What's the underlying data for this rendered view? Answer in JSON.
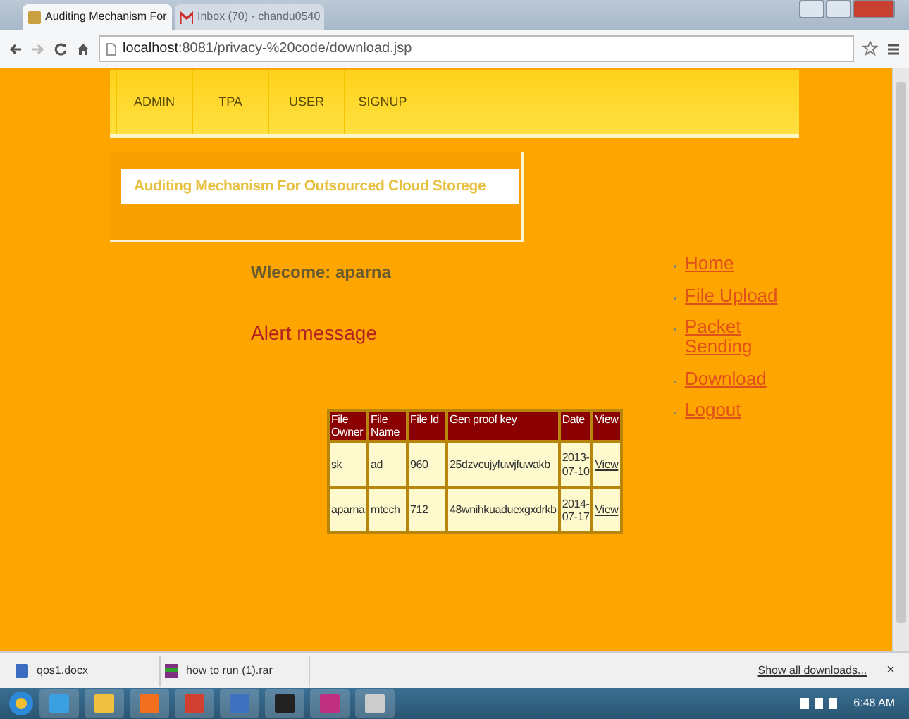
{
  "browser": {
    "tabs": [
      {
        "title": "Auditing Mechanism For",
        "selected": true
      },
      {
        "title": "Inbox (70) - chandu0540",
        "selected": false
      }
    ],
    "url_host": "localhost",
    "url_rest": ":8081/privacy-%20code/download.jsp"
  },
  "nav": [
    "ADMIN",
    "TPA",
    "USER",
    "SIGNUP"
  ],
  "banner": "Auditing Mechanism For Outsourced Cloud Storege",
  "welcome": "Wlecome: aparna",
  "alert": "Alert message",
  "table": {
    "columns": [
      "File Owner",
      "File Name",
      "File Id",
      "Gen proof key",
      "Date",
      "View"
    ],
    "rows": [
      [
        "sk",
        "ad",
        "960",
        "25dzvcujyfuwjfuwakb",
        "2013-07-10",
        "View"
      ],
      [
        "aparna",
        "mtech",
        "712",
        "48wnihkuaduexgxdrkb",
        "2014-07-17",
        "View"
      ]
    ]
  },
  "links": [
    "Home",
    "File Upload",
    "Packet Sending",
    "Download",
    "Logout"
  ],
  "downloads": {
    "items": [
      "qos1.docx",
      "how to run (1).rar"
    ],
    "show_all": "Show all downloads...",
    "close": "×"
  },
  "taskbar": {
    "clock": "6:48 AM"
  }
}
